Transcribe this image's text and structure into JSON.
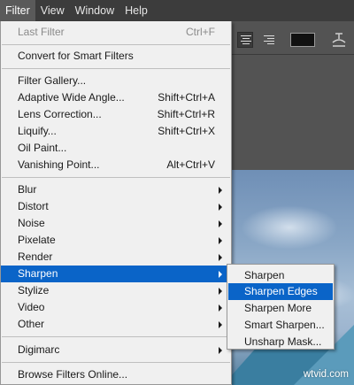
{
  "menubar": {
    "items": [
      {
        "label": "Filter",
        "active": true
      },
      {
        "label": "View"
      },
      {
        "label": "Window"
      },
      {
        "label": "Help"
      }
    ]
  },
  "filter_menu": {
    "last_filter": {
      "label": "Last Filter",
      "shortcut": "Ctrl+F"
    },
    "convert": {
      "label": "Convert for Smart Filters"
    },
    "gallery": {
      "label": "Filter Gallery..."
    },
    "adaptive": {
      "label": "Adaptive Wide Angle...",
      "shortcut": "Shift+Ctrl+A"
    },
    "lens": {
      "label": "Lens Correction...",
      "shortcut": "Shift+Ctrl+R"
    },
    "liquify": {
      "label": "Liquify...",
      "shortcut": "Shift+Ctrl+X"
    },
    "oil": {
      "label": "Oil Paint..."
    },
    "vanishing": {
      "label": "Vanishing Point...",
      "shortcut": "Alt+Ctrl+V"
    },
    "blur": {
      "label": "Blur"
    },
    "distort": {
      "label": "Distort"
    },
    "noise": {
      "label": "Noise"
    },
    "pixelate": {
      "label": "Pixelate"
    },
    "render": {
      "label": "Render"
    },
    "sharpen": {
      "label": "Sharpen"
    },
    "stylize": {
      "label": "Stylize"
    },
    "video": {
      "label": "Video"
    },
    "other": {
      "label": "Other"
    },
    "digimarc": {
      "label": "Digimarc"
    },
    "browse": {
      "label": "Browse Filters Online..."
    }
  },
  "sharpen_submenu": {
    "items": [
      {
        "label": "Sharpen"
      },
      {
        "label": "Sharpen Edges",
        "highlighted": true
      },
      {
        "label": "Sharpen More"
      },
      {
        "label": "Smart Sharpen..."
      },
      {
        "label": "Unsharp Mask..."
      }
    ]
  },
  "options_bar": {
    "color_swatch": "#111111"
  },
  "watermark": "wtvid.com",
  "colors": {
    "highlight": "#0a64c8",
    "menu_bg": "#f0f0f0",
    "menubar_bg": "#3c3c3c"
  }
}
